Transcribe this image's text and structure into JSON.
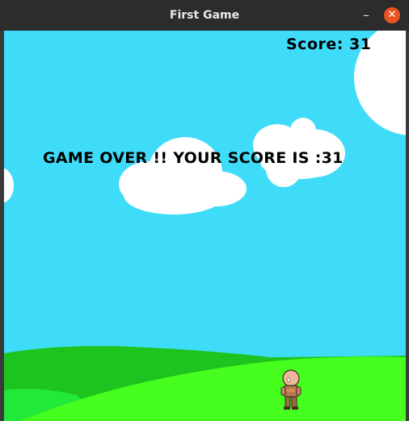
{
  "window": {
    "title": "First Game",
    "minimize_glyph": "–",
    "close_glyph": "✕"
  },
  "game": {
    "score_text": "Score: 31",
    "game_over_text": "GAME OVER !! YOUR SCORE IS :31"
  },
  "colors": {
    "sky": "#3fdcf9",
    "cloud": "#ffffff",
    "hill_back": "#1ec41e",
    "hill_front": "#46ff1e",
    "hill_left": "#22e83a",
    "close_button": "#e95420"
  },
  "icons": {
    "minimize": "minimize-icon",
    "close": "close-icon"
  }
}
